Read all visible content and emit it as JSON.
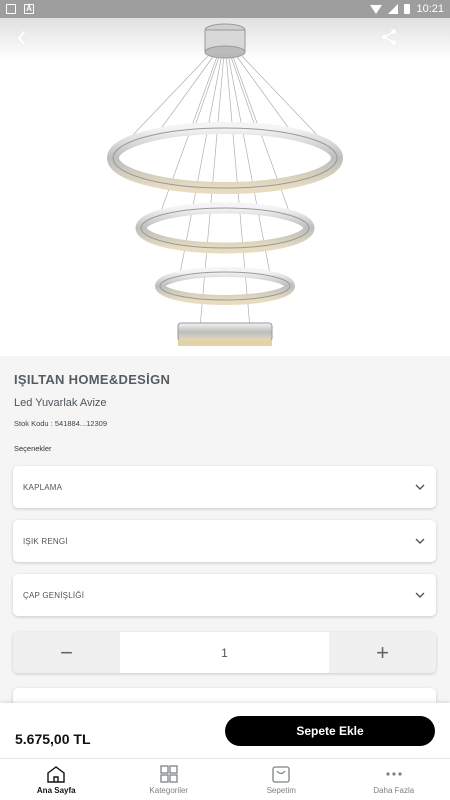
{
  "status_bar": {
    "time": "10:21"
  },
  "product": {
    "brand": "IŞILTAN HOME&DESİGN",
    "name": "Led Yuvarlak Avize",
    "stock_code": "Stok Kodu : 541884...12309"
  },
  "options": {
    "title": "Seçenekler",
    "selects": [
      {
        "label": "KAPLAMA"
      },
      {
        "label": "IŞIK RENGİ"
      },
      {
        "label": "ÇAP GENİŞLİĞİ"
      }
    ]
  },
  "quantity": {
    "minus": "−",
    "value": "1",
    "plus": "+"
  },
  "buy_bar": {
    "price": "5.675,00 TL",
    "add_to_cart": "Sepete Ekle"
  },
  "tabs": [
    {
      "label": "Ana Sayfa",
      "icon": "home-icon"
    },
    {
      "label": "Kategoriler",
      "icon": "grid-icon"
    },
    {
      "label": "Sepetim",
      "icon": "basket-icon"
    },
    {
      "label": "Daha Fazla",
      "icon": "more-icon"
    }
  ],
  "colors": {
    "accent": "#000000",
    "text_muted": "#7a8288"
  }
}
